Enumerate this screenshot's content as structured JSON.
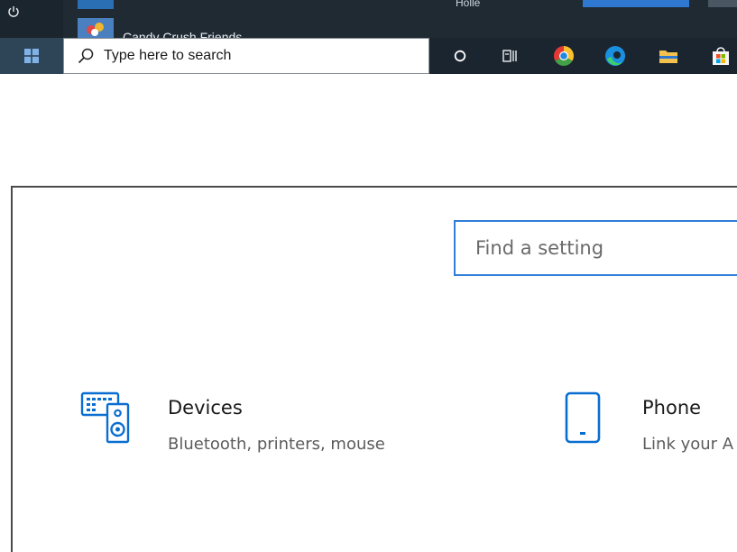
{
  "start_menu": {
    "apps": [
      {
        "label": "Candy Crush Friends",
        "icon": "candy-crush-icon"
      }
    ],
    "tile_label_partial": "Holle"
  },
  "taskbar": {
    "search_placeholder": "Type here to search",
    "icons": [
      "windows-start-icon",
      "cortana-icon",
      "task-view-icon",
      "chrome-icon",
      "edge-icon",
      "file-explorer-icon",
      "microsoft-store-icon"
    ]
  },
  "settings": {
    "search": {
      "placeholder": "Find a setting"
    },
    "categories": [
      {
        "title": "Devices",
        "description": "Bluetooth, printers, mouse",
        "icon": "devices-icon"
      },
      {
        "title": "Phone",
        "description": "Link your A",
        "icon": "phone-icon"
      }
    ],
    "colors": {
      "accent": "#0078d7",
      "text": "#1a1a1a",
      "secondary_text": "#5c5c5c"
    }
  }
}
